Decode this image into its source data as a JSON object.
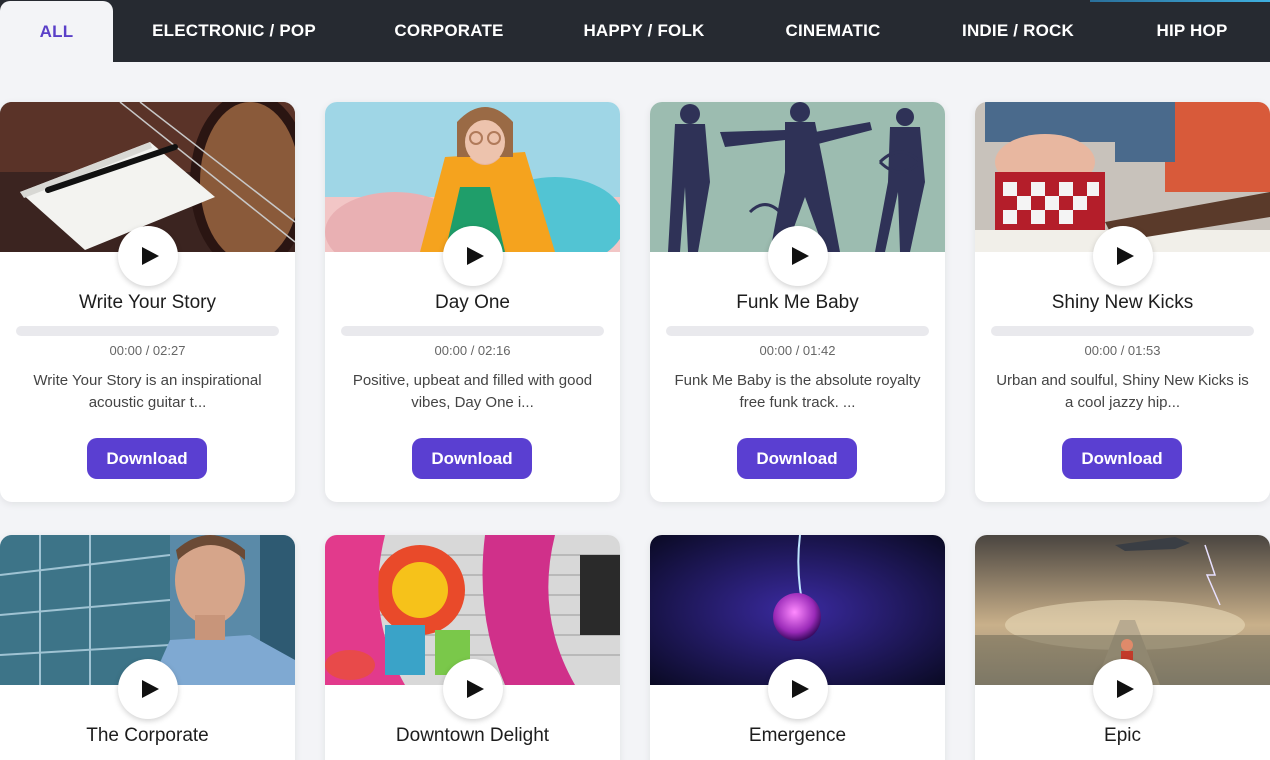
{
  "nav": {
    "tabs": [
      {
        "label": "ALL",
        "active": true
      },
      {
        "label": "ELECTRONIC / POP"
      },
      {
        "label": "CORPORATE"
      },
      {
        "label": "HAPPY / FOLK"
      },
      {
        "label": "CINEMATIC"
      },
      {
        "label": "INDIE / ROCK"
      },
      {
        "label": "HIP HOP"
      }
    ]
  },
  "tracks": [
    {
      "title": "Write Your Story",
      "time": "00:00 / 02:27",
      "description": "Write Your Story is an inspirational acoustic guitar t...",
      "download_label": "Download"
    },
    {
      "title": "Day One",
      "time": "00:00 / 02:16",
      "description": "Positive, upbeat and filled with good vibes, Day One i...",
      "download_label": "Download"
    },
    {
      "title": "Funk Me Baby",
      "time": "00:00 / 01:42",
      "description": "Funk Me Baby is the absolute royalty free funk track. ...",
      "download_label": "Download"
    },
    {
      "title": "Shiny New Kicks",
      "time": "00:00 / 01:53",
      "description": "Urban and soulful, Shiny New Kicks is a cool jazzy hip...",
      "download_label": "Download"
    },
    {
      "title": "The Corporate"
    },
    {
      "title": "Downtown Delight"
    },
    {
      "title": "Emergence"
    },
    {
      "title": "Epic"
    }
  ],
  "colors": {
    "accent": "#5a3fd1",
    "nav_bg": "#262a31",
    "active_tab_text": "#5a3fc8"
  },
  "icons": {
    "play": "play-icon"
  }
}
